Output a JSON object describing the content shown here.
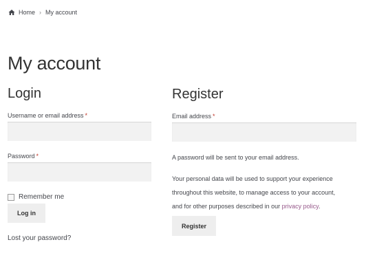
{
  "breadcrumb": {
    "home_label": "Home",
    "separator": "›",
    "current_label": "My account"
  },
  "page_title": "My account",
  "login": {
    "title": "Login",
    "username_label": "Username or email address",
    "username_value": "",
    "password_label": "Password",
    "password_value": "",
    "required_marker": "*",
    "remember_label": "Remember me",
    "remember_checked": false,
    "button_label": "Log in",
    "lost_password_label": "Lost your password?"
  },
  "register": {
    "title": "Register",
    "email_label": "Email address",
    "email_value": "",
    "required_marker": "*",
    "password_note": "A password will be sent to your email address.",
    "privacy_line1": "Your personal data will be used to support your experience",
    "privacy_line2": "throughout this website, to manage access to your account,",
    "privacy_line3_prefix": "and for other purposes described in our ",
    "privacy_link_label": "privacy policy",
    "privacy_line3_suffix": ".",
    "button_label": "Register"
  },
  "colors": {
    "text": "#43454b",
    "heading": "#333333",
    "required": "#c0392b",
    "link_accent": "#96588a",
    "input_bg": "#f2f2f2",
    "button_bg": "#eeeeee"
  },
  "icons": {
    "home": "home-icon",
    "checkbox": "checkbox-icon"
  }
}
